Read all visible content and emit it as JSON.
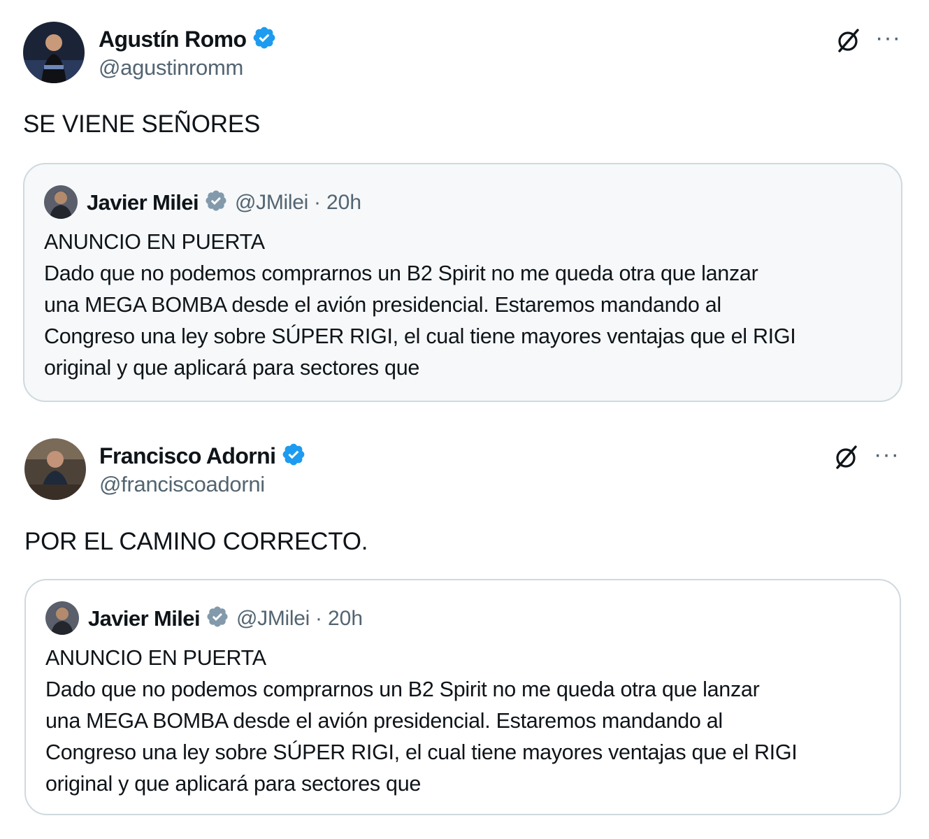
{
  "tweets": [
    {
      "author_name": "Agustín Romo",
      "author_handle": "@agustinromm",
      "verified": true,
      "text": "SE VIENE SEÑORES",
      "grok_icon": "grok-icon",
      "more_label": "···",
      "quote": {
        "author_name": "Javier Milei",
        "author_handle": "@JMilei",
        "separator": "·",
        "time": "20h",
        "lines": [
          "ANUNCIO EN PUERTA",
          "Dado que no podemos comprarnos un B2 Spirit no me queda otra que lanzar",
          "una MEGA BOMBA desde el avión presidencial. Estaremos mandando al",
          "Congreso una ley sobre SÚPER RIGI, el cual tiene mayores ventajas que el RIGI",
          "original y que aplicará para sectores que"
        ]
      }
    },
    {
      "author_name": "Francisco Adorni",
      "author_handle": "@franciscoadorni",
      "verified": true,
      "text": "POR EL CAMINO CORRECTO.",
      "grok_icon": "grok-icon",
      "more_label": "···",
      "quote": {
        "author_name": "Javier Milei",
        "author_handle": "@JMilei",
        "separator": "·",
        "time": "20h",
        "lines": [
          "ANUNCIO EN PUERTA",
          "Dado que no podemos comprarnos un B2 Spirit no me queda otra que lanzar",
          "una MEGA BOMBA desde el avión presidencial. Estaremos mandando al",
          "Congreso una ley sobre SÚPER RIGI, el cual tiene mayores ventajas que el RIGI",
          "original y que aplicará para sectores que"
        ]
      }
    }
  ],
  "colors": {
    "text": "#0f1419",
    "secondary": "#536471",
    "verified_blue": "#1d9bf0",
    "verified_gray": "#829aab",
    "quote_border": "#cfd9de",
    "quote_bg_first": "#f6f8f9"
  }
}
